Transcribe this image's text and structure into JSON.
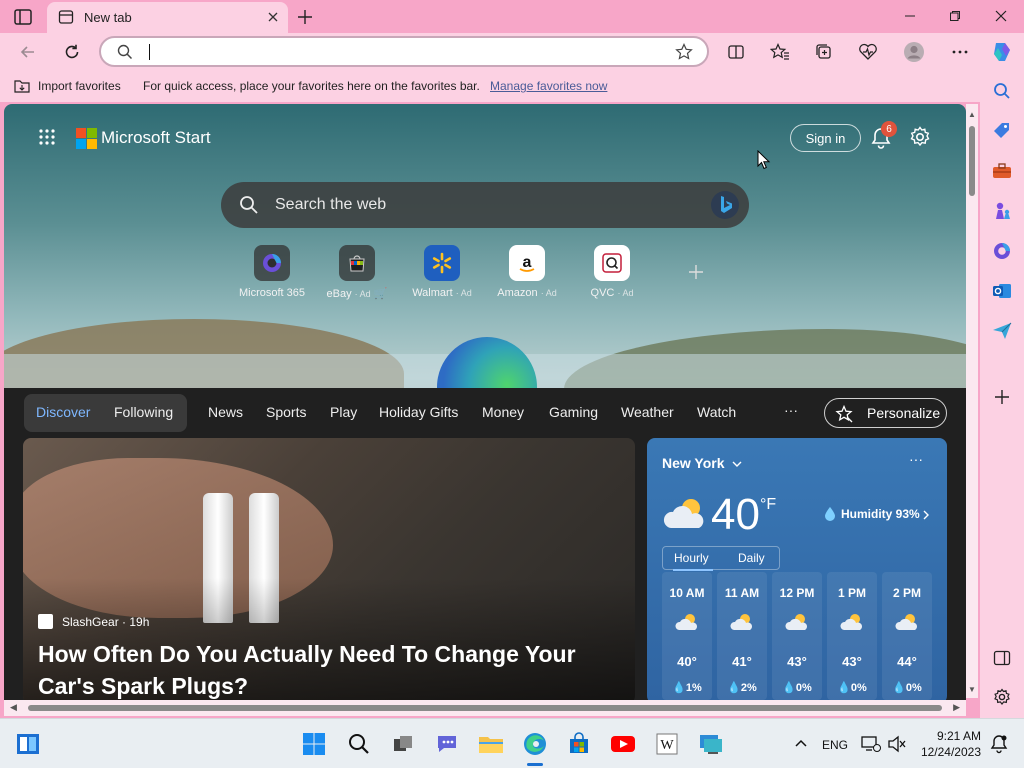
{
  "browser": {
    "tab_title": "New tab",
    "address_value": "",
    "favorites_bar": {
      "import_label": "Import favorites",
      "message": "For quick access, place your favorites here on the favorites bar.",
      "manage_link": "Manage favorites now"
    }
  },
  "start_page": {
    "brand": "Microsoft Start",
    "sign_in": "Sign in",
    "notification_count": "6",
    "search_placeholder": "Search the web",
    "quick_links": [
      {
        "label": "Microsoft 365",
        "ad": ""
      },
      {
        "label": "eBay",
        "ad": "· Ad"
      },
      {
        "label": "Walmart",
        "ad": "· Ad"
      },
      {
        "label": "Amazon",
        "ad": "· Ad"
      },
      {
        "label": "QVC",
        "ad": "· Ad"
      }
    ]
  },
  "feed": {
    "pills": [
      "Discover",
      "Following"
    ],
    "nav": [
      "News",
      "Sports",
      "Play",
      "Holiday Gifts",
      "Money",
      "Gaming",
      "Weather",
      "Watch"
    ],
    "more": "···",
    "personalize": "Personalize",
    "hero": {
      "source": "SlashGear · 19h",
      "headline": "How Often Do You Actually Need To Change Your Car's Spark Plugs?"
    }
  },
  "weather": {
    "city": "New York",
    "more": "···",
    "temp": "40",
    "unit": "°F",
    "humidity": "Humidity 93%",
    "tabs": [
      "Hourly",
      "Daily"
    ],
    "hourly": [
      {
        "hour": "10 AM",
        "temp": "40°",
        "precip": "1%"
      },
      {
        "hour": "11 AM",
        "temp": "41°",
        "precip": "2%"
      },
      {
        "hour": "12 PM",
        "temp": "43°",
        "precip": "0%"
      },
      {
        "hour": "1 PM",
        "temp": "43°",
        "precip": "0%"
      },
      {
        "hour": "2 PM",
        "temp": "44°",
        "precip": "0%"
      }
    ]
  },
  "taskbar": {
    "lang": "ENG",
    "time": "9:21 AM",
    "date": "12/24/2023"
  },
  "colors": {
    "chrome_pink": "#f7a6c8",
    "feed_bg": "#202020",
    "weather_blue": "#3a78b5",
    "badge_red": "#e0533c"
  }
}
